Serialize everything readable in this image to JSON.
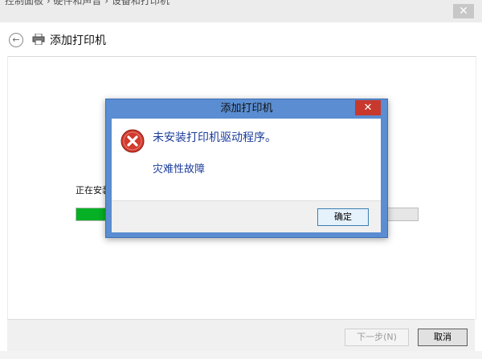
{
  "breadcrumb": "控制面板 › 硬件和声音 › 设备和打印机",
  "window": {
    "close_glyph": "✕"
  },
  "header": {
    "back_glyph": "←",
    "title": "添加打印机"
  },
  "wizard": {
    "status_text": "正在安装",
    "progress": 0.1
  },
  "footer": {
    "next_label": "下一步(N)",
    "cancel_label": "取消"
  },
  "dialog": {
    "title": "添加打印机",
    "close_glyph": "✕",
    "message": "未安装打印机驱动程序。",
    "detail": "灾难性故障",
    "ok_label": "确定"
  },
  "colors": {
    "accent": "#5a8dd1",
    "error": "#c8382c",
    "progress": "#06b025",
    "message_text": "#1a3c9a"
  }
}
